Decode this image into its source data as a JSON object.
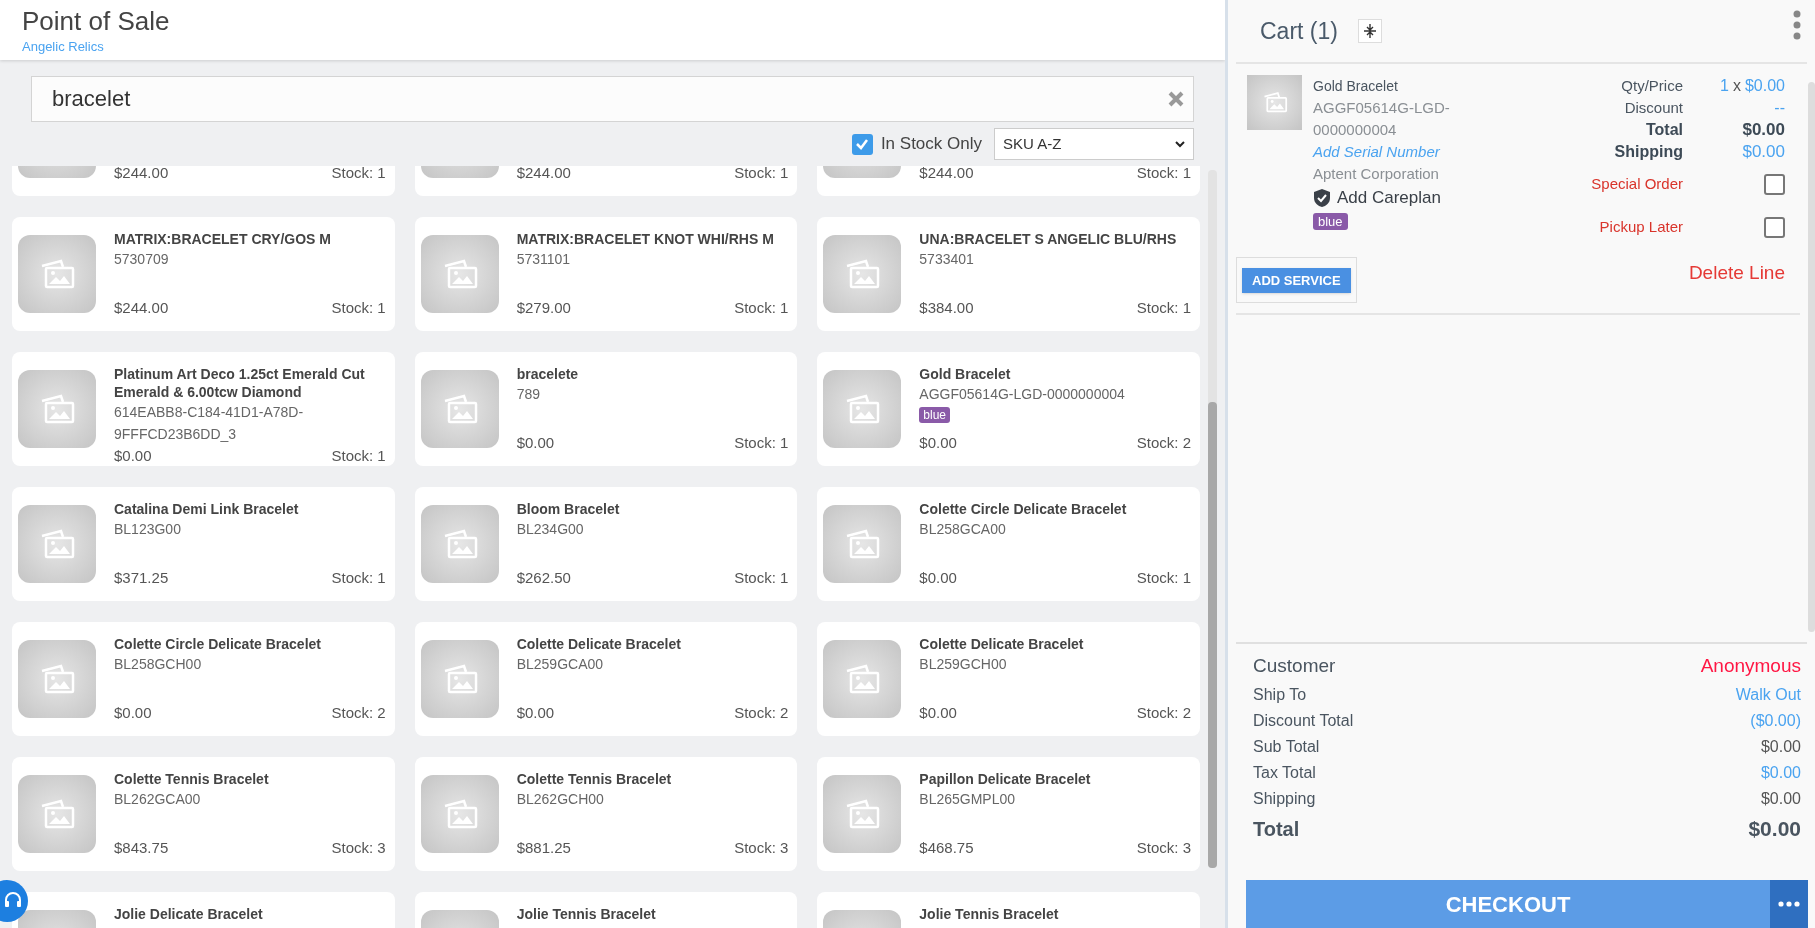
{
  "header": {
    "title": "Point of Sale",
    "subtitle": "Angelic Relics"
  },
  "search": {
    "value": "bracelet"
  },
  "filters": {
    "in_stock": {
      "label": "In Stock Only",
      "checked": true
    },
    "sort": {
      "value": "SKU A-Z"
    }
  },
  "products": [
    {
      "price": "$244.00",
      "stock": "Stock: 1"
    },
    {
      "price": "$244.00",
      "stock": "Stock: 1"
    },
    {
      "price": "$244.00",
      "stock": "Stock: 1"
    },
    {
      "name": "MATRIX:BRACELET CRY/GOS M",
      "sku": "5730709",
      "price": "$244.00",
      "stock": "Stock: 1"
    },
    {
      "name": "MATRIX:BRACELET KNOT WHI/RHS M",
      "sku": "5731101",
      "price": "$279.00",
      "stock": "Stock: 1"
    },
    {
      "name": "UNA:BRACELET S ANGELIC BLU/RHS",
      "sku": "5733401",
      "price": "$384.00",
      "stock": "Stock: 1"
    },
    {
      "name": "Platinum Art Deco 1.25ct Emerald Cut Emerald & 6.00tcw Diamond",
      "sku": "614EABB8-C184-41D1-A78D-9FFFCD23B6DD_3",
      "price": "$0.00",
      "stock": "Stock: 1"
    },
    {
      "name": "bracelete",
      "sku": "789",
      "price": "$0.00",
      "stock": "Stock: 1"
    },
    {
      "name": "Gold Bracelet",
      "sku": "AGGF05614G-LGD-0000000004",
      "tag": "blue",
      "price": "$0.00",
      "stock": "Stock: 2"
    },
    {
      "name": "Catalina Demi Link Bracelet",
      "sku": "BL123G00",
      "price": "$371.25",
      "stock": "Stock: 1"
    },
    {
      "name": "Bloom Bracelet",
      "sku": "BL234G00",
      "price": "$262.50",
      "stock": "Stock: 1"
    },
    {
      "name": "Colette Circle Delicate Bracelet",
      "sku": "BL258GCA00",
      "price": "$0.00",
      "stock": "Stock: 1"
    },
    {
      "name": "Colette Circle Delicate Bracelet",
      "sku": "BL258GCH00",
      "price": "$0.00",
      "stock": "Stock: 2"
    },
    {
      "name": "Colette Delicate Bracelet",
      "sku": "BL259GCA00",
      "price": "$0.00",
      "stock": "Stock: 2"
    },
    {
      "name": "Colette Delicate Bracelet",
      "sku": "BL259GCH00",
      "price": "$0.00",
      "stock": "Stock: 2"
    },
    {
      "name": "Colette Tennis Bracelet",
      "sku": "BL262GCA00",
      "price": "$843.75",
      "stock": "Stock: 3"
    },
    {
      "name": "Colette Tennis Bracelet",
      "sku": "BL262GCH00",
      "price": "$881.25",
      "stock": "Stock: 3"
    },
    {
      "name": "Papillon Delicate Bracelet",
      "sku": "BL265GMPL00",
      "price": "$468.75",
      "stock": "Stock: 3"
    },
    {
      "name": "Jolie Delicate Bracelet"
    },
    {
      "name": "Jolie Tennis Bracelet"
    },
    {
      "name": "Jolie Tennis Bracelet"
    }
  ],
  "cart": {
    "title": "Cart (1)",
    "items": [
      {
        "name": "Gold Bracelet",
        "sku": "AGGF05614G-LGD-0000000004",
        "serial_link": "Add Serial Number",
        "vendor": "Aptent Corporation",
        "careplan": "Add Careplan",
        "tag": "blue",
        "add_service": "ADD SERVICE",
        "fields": [
          {
            "kind": "qty",
            "label": "Qty/Price",
            "qty": "1",
            "times": "x",
            "value": "$0.00"
          },
          {
            "kind": "link",
            "label": "Discount",
            "value": "--"
          },
          {
            "kind": "bold",
            "label": "Total",
            "value": "$0.00"
          },
          {
            "kind": "boldlink",
            "label": "Shipping",
            "value": "$0.00"
          },
          {
            "kind": "check",
            "label": "Special Order",
            "checked": false
          },
          {
            "kind": "check",
            "label": "Pickup Later",
            "checked": false
          }
        ],
        "delete": "Delete Line"
      }
    ],
    "summary": [
      {
        "kind": "customer",
        "color": "#ff1744",
        "label": "Customer",
        "value": "Anonymous"
      },
      {
        "kind": "line",
        "color": "#4aa3f0",
        "label": "Ship To",
        "value": "Walk Out"
      },
      {
        "kind": "line",
        "color": "#4aa3f0",
        "label": "Discount Total",
        "value": "($0.00)"
      },
      {
        "kind": "line",
        "color": "#555555",
        "label": "Sub Total",
        "value": "$0.00"
      },
      {
        "kind": "line",
        "color": "#4aa3f0",
        "label": "Tax Total",
        "value": "$0.00"
      },
      {
        "kind": "line",
        "color": "#555555",
        "label": "Shipping",
        "value": "$0.00"
      },
      {
        "kind": "total",
        "color": "#4a5560",
        "label": "Total",
        "value": "$0.00"
      }
    ],
    "checkout": "CHECKOUT"
  }
}
